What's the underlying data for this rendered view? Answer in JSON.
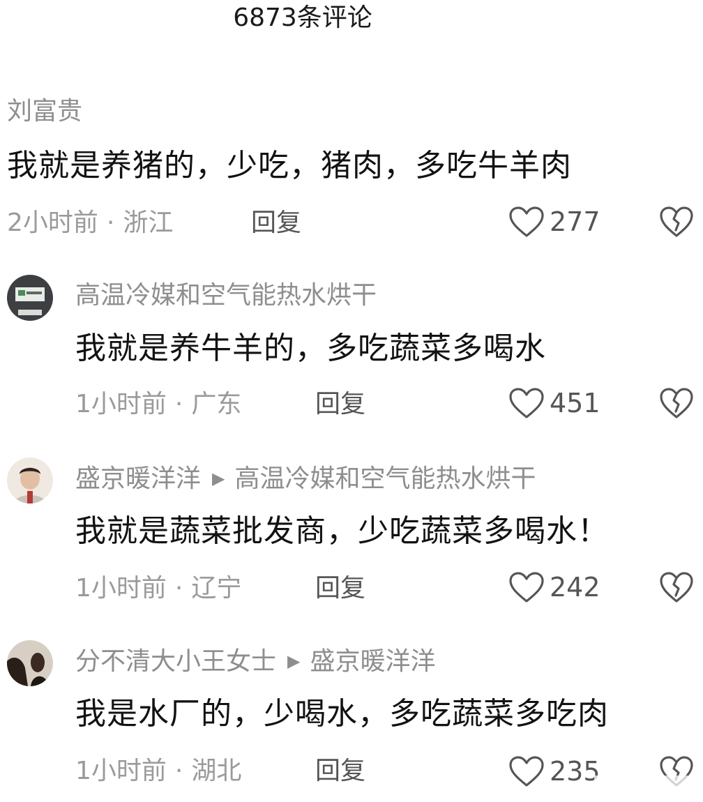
{
  "header": {
    "title": "6873条评论"
  },
  "comments": [
    {
      "user": "刘富贵",
      "reply_to": "",
      "text": "我就是养猪的，少吃，猪肉，多吃牛羊肉",
      "time": "2小时前",
      "location": "浙江",
      "reply_label": "回复",
      "likes": "277"
    },
    {
      "user": "高温冷媒和空气能热水烘干",
      "reply_to": "",
      "text": "我就是养牛羊的，多吃蔬菜多喝水",
      "time": "1小时前",
      "location": "广东",
      "reply_label": "回复",
      "likes": "451"
    },
    {
      "user": "盛京暖洋洋",
      "reply_to": "高温冷媒和空气能热水烘干",
      "text": "我就是蔬菜批发商，少吃蔬菜多喝水！",
      "time": "1小时前",
      "location": "辽宁",
      "reply_label": "回复",
      "likes": "242"
    },
    {
      "user": "分不清大小王女士",
      "reply_to": "盛京暖洋洋",
      "text": "我是水厂的，少喝水，多吃蔬菜多吃肉",
      "time": "1小时前",
      "location": "湖北",
      "reply_label": "回复",
      "likes": "235"
    }
  ],
  "icons": {
    "like": "heart-outline-icon",
    "dislike": "broken-heart-icon",
    "reply_arrow": "triangle-right-icon"
  },
  "colors": {
    "username": "#8e8e8e",
    "text": "#121212",
    "meta": "#9a9a9a",
    "icon": "#555555"
  }
}
